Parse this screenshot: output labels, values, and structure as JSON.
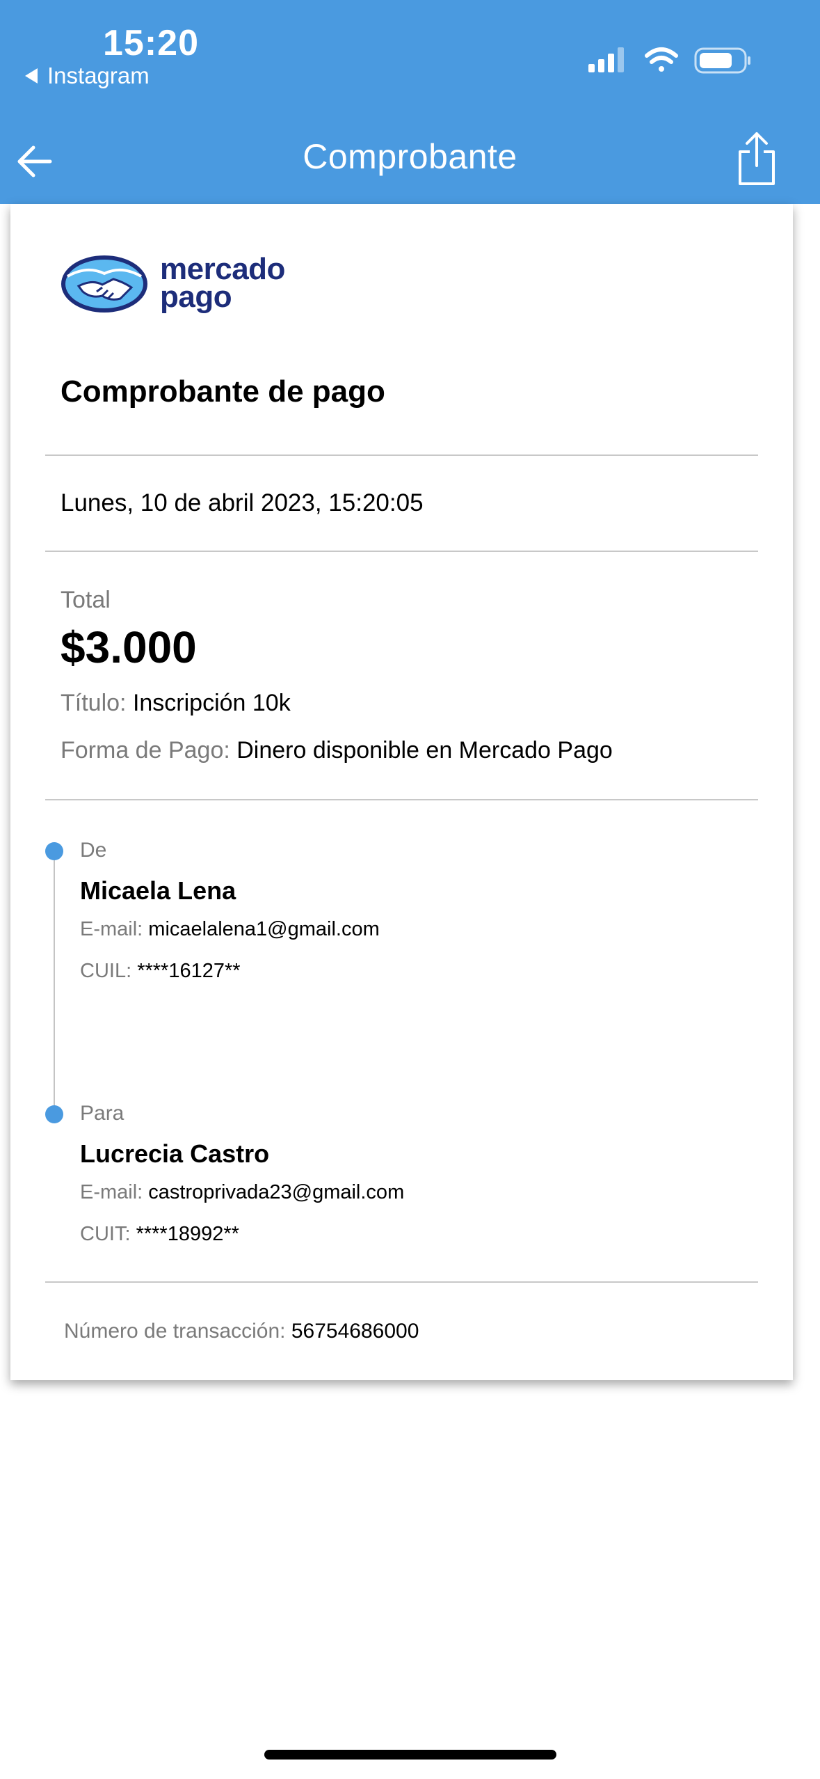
{
  "status_bar": {
    "time": "15:20",
    "back_app": "Instagram",
    "icons": [
      "signal-icon",
      "wifi-icon",
      "battery-icon"
    ]
  },
  "nav": {
    "title": "Comprobante",
    "back_icon": "arrow-left-icon",
    "share_icon": "share-icon"
  },
  "receipt": {
    "logo_text_line1": "mercado",
    "logo_text_line2": "pago",
    "title": "Comprobante de pago",
    "date": "Lunes, 10 de abril 2023, 15:20:05",
    "total_label": "Total",
    "total_amount": "$3.000",
    "titulo_label": "Título:",
    "titulo_value": "Inscripción 10k",
    "forma_label": "Forma de Pago:",
    "forma_value": "Dinero disponible en Mercado Pago",
    "from": {
      "label": "De",
      "name": "Micaela Lena",
      "email_label": "E-mail:",
      "email": "micaelalena1@gmail.com",
      "id_label": "CUIL:",
      "id_value": "****16127**"
    },
    "to": {
      "label": "Para",
      "name": "Lucrecia Castro",
      "email_label": "E-mail:",
      "email": "castroprivada23@gmail.com",
      "id_label": "CUIT:",
      "id_value": "****18992**"
    },
    "transaction_label": "Número de transacción:",
    "transaction_number": "56754686000"
  },
  "colors": {
    "header": "#4a9ae0",
    "brand_navy": "#1d2d7a",
    "brand_light_blue": "#5bb8f0"
  }
}
